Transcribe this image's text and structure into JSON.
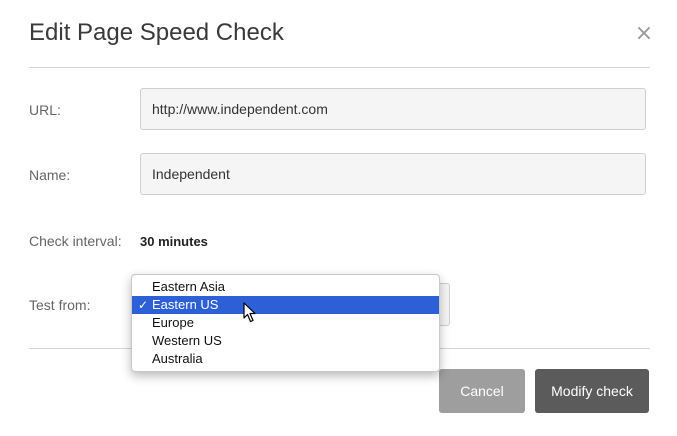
{
  "dialog": {
    "title": "Edit Page Speed Check",
    "close_label": "×"
  },
  "form": {
    "url": {
      "label": "URL:",
      "value": "http://www.independent.com"
    },
    "name": {
      "label": "Name:",
      "value": "Independent"
    },
    "interval": {
      "label": "Check interval:",
      "value": "30 minutes"
    },
    "test_from": {
      "label": "Test from:",
      "selected": "Eastern US",
      "options": [
        "Eastern Asia",
        "Eastern US",
        "Europe",
        "Western US",
        "Australia"
      ],
      "check_glyph": "✓"
    }
  },
  "actions": {
    "cancel_label": "Cancel",
    "modify_label": "Modify check"
  },
  "colors": {
    "selected_option_bg": "#2d5fd6",
    "cancel_bg": "#9e9e9e",
    "modify_bg": "#5b5b5b"
  }
}
